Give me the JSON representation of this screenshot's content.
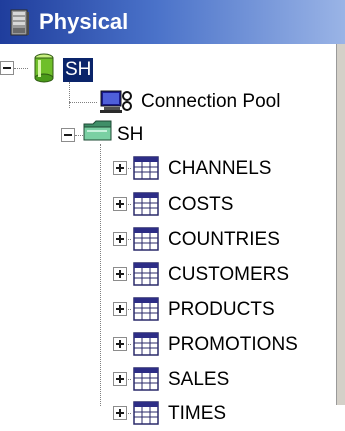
{
  "header": {
    "title": "Physical",
    "icon": "server-icon"
  },
  "tree": {
    "root": {
      "label": "SH",
      "icon": "database-icon",
      "expanded": true,
      "selected": true
    },
    "connection_pool": {
      "label": "Connection Pool",
      "icon": "connection-pool-icon"
    },
    "schema": {
      "label": "SH",
      "icon": "folder-icon",
      "expanded": true
    },
    "tables": [
      {
        "label": "CHANNELS",
        "icon": "table-icon"
      },
      {
        "label": "COSTS",
        "icon": "table-icon"
      },
      {
        "label": "COUNTRIES",
        "icon": "table-icon"
      },
      {
        "label": "CUSTOMERS",
        "icon": "table-icon"
      },
      {
        "label": "PRODUCTS",
        "icon": "table-icon"
      },
      {
        "label": "PROMOTIONS",
        "icon": "table-icon"
      },
      {
        "label": "SALES",
        "icon": "table-icon"
      },
      {
        "label": "TIMES",
        "icon": "table-icon"
      }
    ]
  },
  "colors": {
    "header_start": "#1f3d9c",
    "header_end": "#9ab4e6",
    "selection": "#0a246a"
  }
}
